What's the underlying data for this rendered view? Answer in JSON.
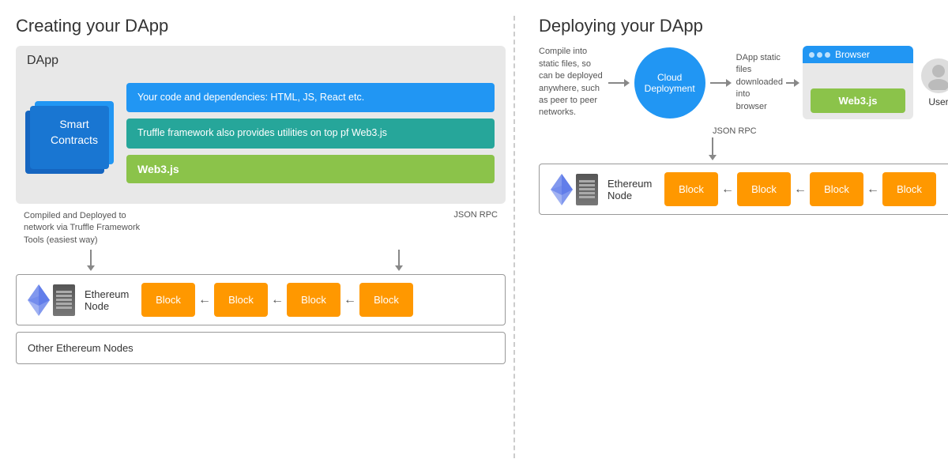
{
  "left_title": "Creating your DApp",
  "right_title": "Deploying your DApp",
  "dapp_label": "DApp",
  "smart_contracts_label": "Smart\nContracts",
  "code_box_text": "Your code and dependencies: HTML, JS, React etc.",
  "truffle_box_text": "Truffle framework also provides utilities on top pf Web3.js",
  "web3_label": "Web3.js",
  "web3_browser_label": "Web3.js",
  "compiled_deployed_text": "Compiled and Deployed to network via Truffle Framework Tools (easiest way)",
  "json_rpc_label": "JSON RPC",
  "json_rpc_right_label": "JSON RPC",
  "ethereum_node_label": "Ethereum\nNode",
  "ethereum_node_right_label": "Ethereum\nNode",
  "other_nodes_label": "Other Ethereum Nodes",
  "blocks": [
    "Block",
    "Block",
    "Block",
    "Block"
  ],
  "blocks_right": [
    "Block",
    "Block",
    "Block",
    "Block"
  ],
  "compile_text": "Compile into static files, so can be deployed anywhere, such as peer to peer networks.",
  "cloud_label": "Cloud\nDeployment",
  "dapp_static_text": "DApp static files downloaded into browser",
  "browser_label": "Browser",
  "browser_dots": [
    "•",
    "•",
    "•"
  ],
  "user_label": "User"
}
